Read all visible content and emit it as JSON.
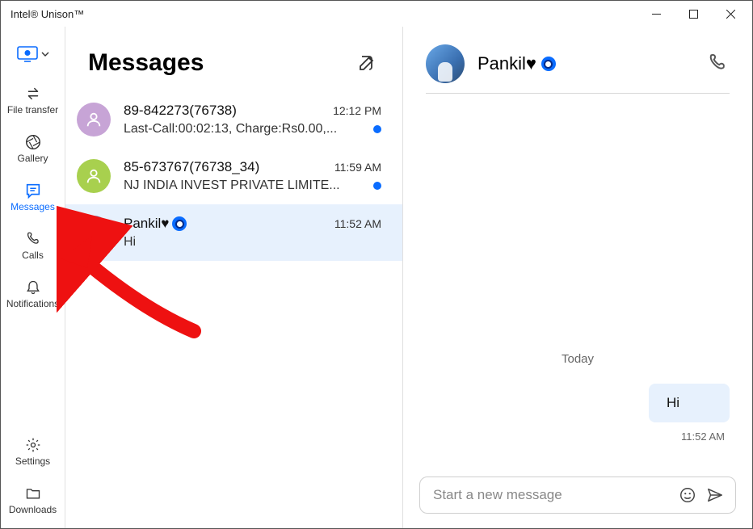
{
  "window": {
    "title": "Intel® Unison™"
  },
  "sidebar": {
    "items": [
      {
        "label": "File transfer"
      },
      {
        "label": "Gallery"
      },
      {
        "label": "Messages"
      },
      {
        "label": "Calls"
      },
      {
        "label": "Notifications"
      }
    ],
    "footer": [
      {
        "label": "Settings"
      },
      {
        "label": "Downloads"
      }
    ]
  },
  "list": {
    "title": "Messages",
    "conversations": [
      {
        "name": "89-842273(76738)",
        "time": "12:12 PM",
        "preview": "Last-Call:00:02:13, Charge:Rs0.00,...",
        "unread": true,
        "avatar": "purple"
      },
      {
        "name": "85-673767(76738_34)",
        "time": "11:59 AM",
        "preview": "NJ INDIA INVEST PRIVATE LIMITE...",
        "unread": true,
        "avatar": "green"
      },
      {
        "name": "Pankil♥",
        "time": "11:52 AM",
        "preview": "Hi",
        "unread": false,
        "avatar": "photo",
        "eye_badge": true,
        "selected": true
      }
    ]
  },
  "chat": {
    "title": "Pankil♥",
    "eye_badge": true,
    "day_label": "Today",
    "messages": [
      {
        "text": "Hi",
        "time": "11:52 AM",
        "outgoing": true
      }
    ],
    "compose_placeholder": "Start a new message"
  },
  "colors": {
    "accent": "#0a6cff",
    "selected_bg": "#e7f1fd"
  }
}
